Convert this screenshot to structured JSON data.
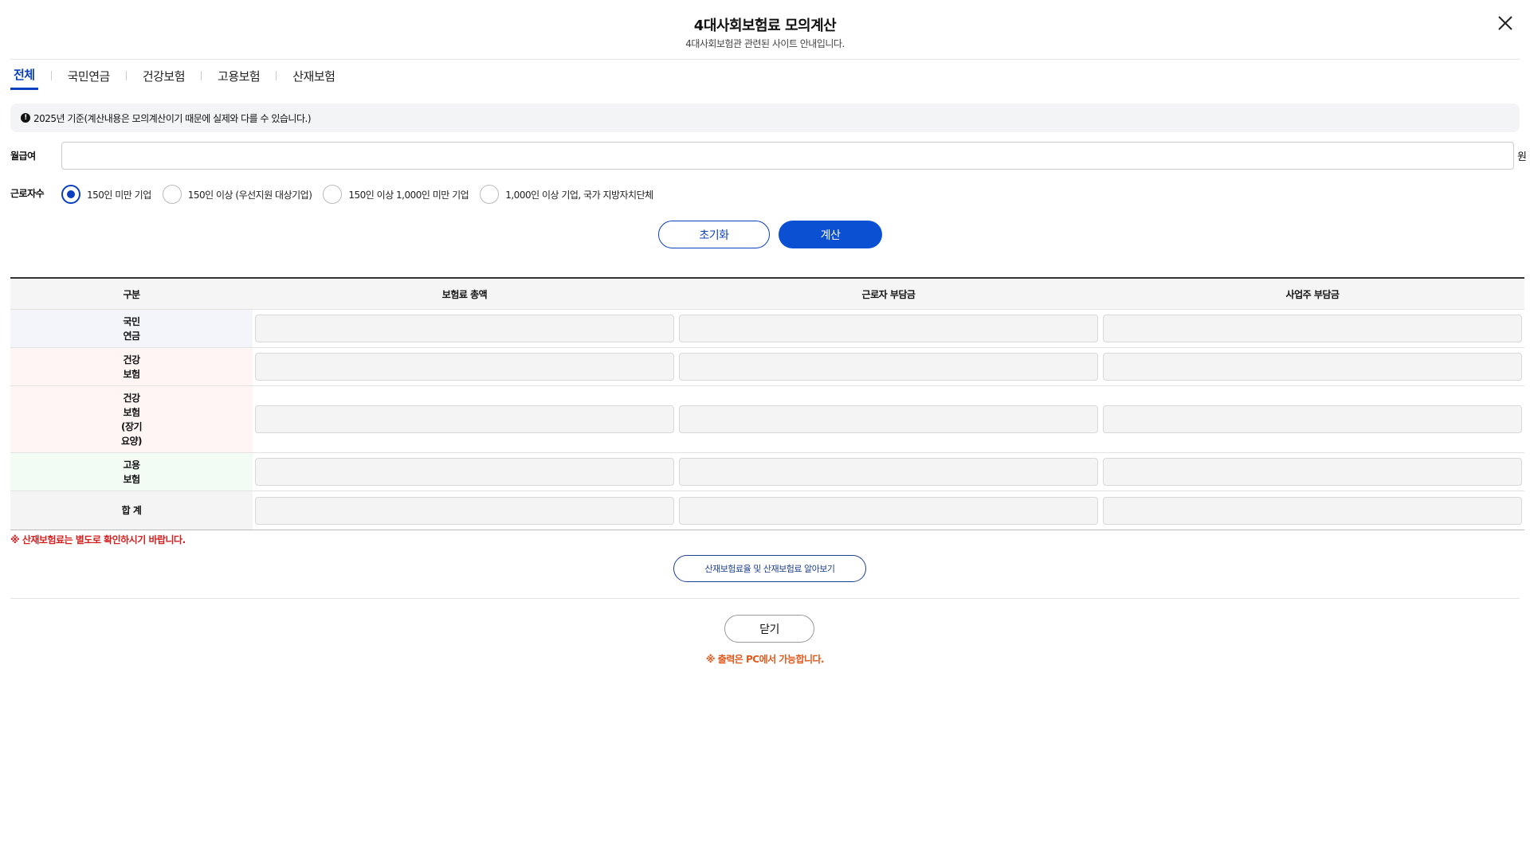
{
  "header": {
    "title": "4대사회보험료 모의계산",
    "subtitle": "4대사회보험관 관련된 사이트 안내입니다."
  },
  "tabs": [
    {
      "label": "전체",
      "active": true
    },
    {
      "label": "국민연금",
      "active": false
    },
    {
      "label": "건강보험",
      "active": false
    },
    {
      "label": "고용보험",
      "active": false
    },
    {
      "label": "산재보험",
      "active": false
    }
  ],
  "notice": {
    "icon": "info-icon",
    "text": "2025년 기준(계산내용은 모의계산이기 때문에 실제와 다를 수 있습니다.)"
  },
  "salary": {
    "label": "월급여",
    "value": "",
    "unit": "원"
  },
  "workers": {
    "label": "근로자수",
    "options": [
      {
        "label": "150인 미만 기업",
        "checked": true
      },
      {
        "label": "150인 이상 (우선지원 대상기업)",
        "checked": false
      },
      {
        "label": "150인 이상 1,000인 미만 기업",
        "checked": false
      },
      {
        "label": "1,000인 이상 기업, 국가 지방자치단체",
        "checked": false
      }
    ]
  },
  "buttons": {
    "reset": "초기화",
    "calculate": "계산",
    "industrial": "산재보험료율 및 산재보험료 알아보기",
    "close": "닫기"
  },
  "table": {
    "headers": [
      "구분",
      "보험료 총액",
      "근로자 부담금",
      "사업주 부담금"
    ],
    "rows": [
      {
        "category": "국민\n연금",
        "bg": "#f4f5fb",
        "values": [
          "",
          "",
          ""
        ]
      },
      {
        "category": "건강\n보험",
        "bg": "#fff5f5",
        "values": [
          "",
          "",
          ""
        ]
      },
      {
        "category": "건강\n보험\n(장기\n요양)",
        "bg": "#fff5f5",
        "values": [
          "",
          "",
          ""
        ]
      },
      {
        "category": "고용\n보험",
        "bg": "#f3fbf5",
        "values": [
          "",
          "",
          ""
        ]
      },
      {
        "category": "합 계",
        "bg": "#f4f4f4",
        "values": [
          "",
          "",
          ""
        ]
      }
    ]
  },
  "notes": {
    "industrial": "※ 산재보험료는 별도로 확인하시기 바랍니다.",
    "print": "※ 출력은 PC에서 가능합니다."
  }
}
